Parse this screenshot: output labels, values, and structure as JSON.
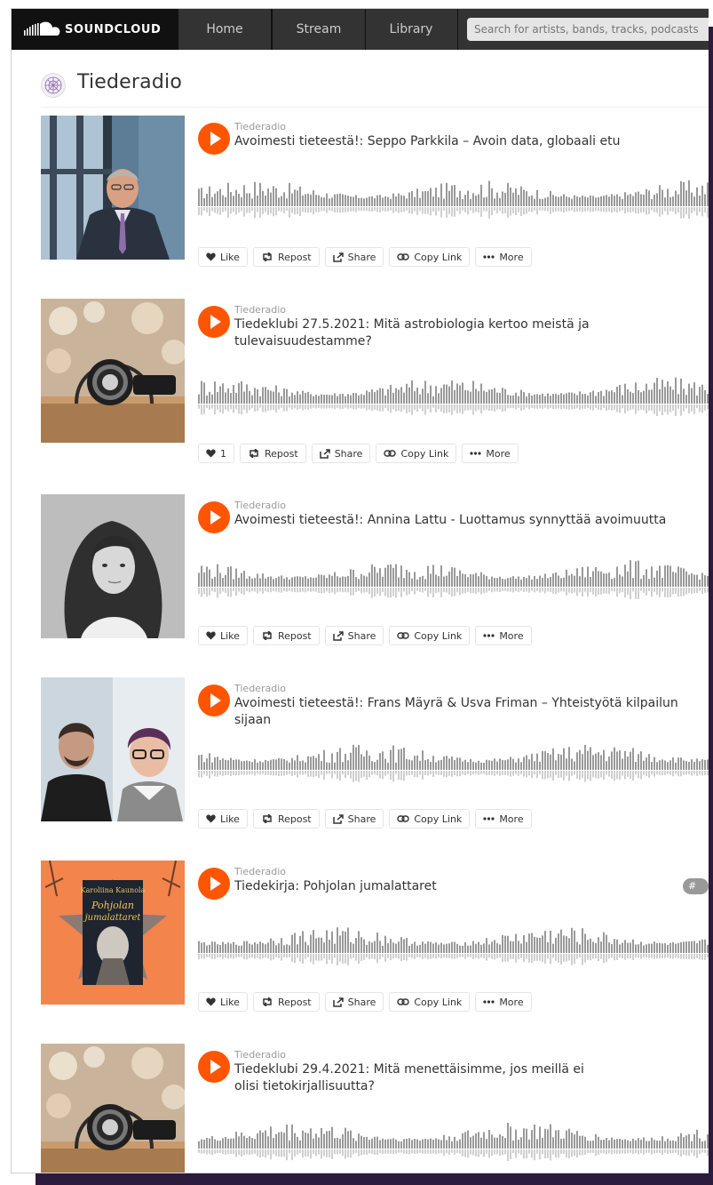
{
  "header": {
    "brand": "SOUNDCLOUD",
    "nav": [
      "Home",
      "Stream",
      "Library"
    ],
    "search_placeholder": "Search for artists, bands, tracks, podcasts"
  },
  "user": {
    "name": "Tiederadio"
  },
  "colors": {
    "accent": "#ff5500",
    "topbar": "#333333",
    "logo_bg": "#111111",
    "backdrop": "#2c1b3c"
  },
  "actions": {
    "like": "Like",
    "repost": "Repost",
    "share": "Share",
    "copy_link": "Copy Link",
    "more": "More"
  },
  "tracks": [
    {
      "uploader": "Tiederadio",
      "title": "Avoimesti tieteestä!: Seppo Parkkila – Avoin data, globaali etu",
      "likes": "Like"
    },
    {
      "uploader": "Tiederadio",
      "title": "Tiedeklubi 27.5.2021: Mitä astrobiologia kertoo meistä ja tulevaisuudestamme?",
      "likes": "1"
    },
    {
      "uploader": "Tiederadio",
      "title": "Avoimesti tieteestä!: Annina Lattu - Luottamus synnyttää avoimuutta",
      "likes": "Like"
    },
    {
      "uploader": "Tiederadio",
      "title": "Avoimesti tieteestä!: Frans Mäyrä & Usva Friman – Yhteistyötä kilpailun sijaan",
      "likes": "Like"
    },
    {
      "uploader": "Tiederadio",
      "title": "Tiedekirja: Pohjolan jumalattaret",
      "likes": "Like",
      "tag": "# ka"
    },
    {
      "uploader": "Tiederadio",
      "title": "Tiedeklubi 29.4.2021: Mitä menettäisimme, jos meillä ei olisi tietokirjallisuutta?",
      "likes": ""
    }
  ],
  "book_cover": {
    "author": "Karoliina Kaunola",
    "title_line1": "Pohjolan",
    "title_line2": "jumalattaret"
  }
}
